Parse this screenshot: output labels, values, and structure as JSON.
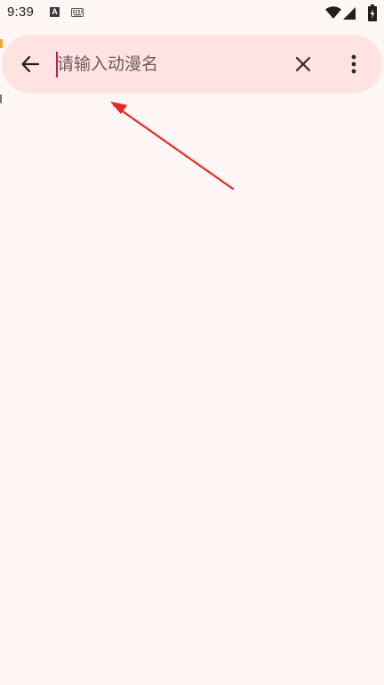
{
  "status_bar": {
    "time": "9:39",
    "a_icon_letter": "A",
    "icons": [
      "a-badge-icon",
      "keyboard-icon",
      "wifi-icon",
      "signal-icon",
      "battery-charging-icon"
    ]
  },
  "search_bar": {
    "placeholder": "请输入动漫名",
    "value": "",
    "back_icon": "arrow-left-icon",
    "clear_icon": "close-icon",
    "more_icon": "more-vertical-icon"
  },
  "colors": {
    "background": "#FFF7F5",
    "search_bar_bg": "#FFE3E3",
    "caret": "#b0214a",
    "annotation_arrow": "#e8262a"
  }
}
